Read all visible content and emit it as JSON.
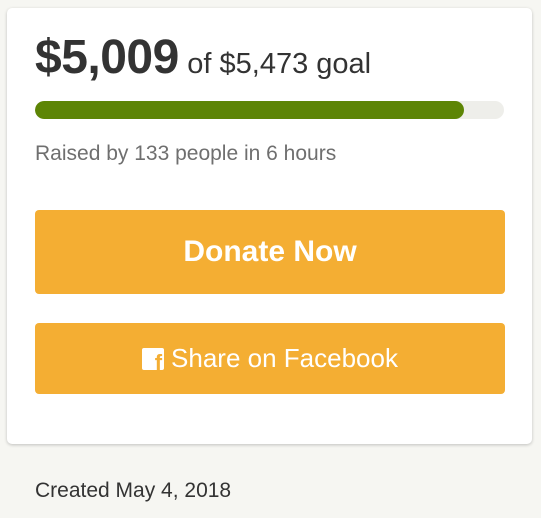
{
  "campaign": {
    "raised_amount": "$5,009",
    "goal_text": "of $5,473 goal",
    "progress_fraction": 0.915,
    "raised_by_text": "Raised by 133 people in 6 hours",
    "donate_label": "Donate Now",
    "share_label": "Share on Facebook",
    "share_icon": "facebook-icon",
    "created_text": "Created May 4, 2018"
  },
  "colors": {
    "progress_fill": "#5d8505",
    "button": "#f4ae33"
  }
}
